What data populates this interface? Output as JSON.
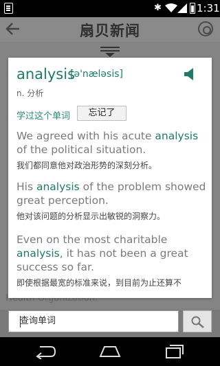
{
  "status_bar": {
    "time": "1:31",
    "icons": [
      "notification-icon",
      "bluetooth-icon",
      "wifi-icon",
      "signal-icon",
      "battery-icon"
    ]
  },
  "app_bar": {
    "title": "扇贝新闻",
    "back_icon": "back-arrow-icon",
    "settings_icon": "gear-icon"
  },
  "card": {
    "word": "analysis",
    "phonetic": "[ə'næləsis]",
    "part_of_speech": "n. 分析",
    "learn_link": "学过这个单词",
    "forgot_button": "忘记了",
    "examples": [
      {
        "en_before": "We agreed with his acute ",
        "en_highlight": "analysis",
        "en_after": " of the political situation.",
        "zh": "我们都同意他对政治形势的深刻分析。"
      },
      {
        "en_before": "His ",
        "en_highlight": "analysis",
        "en_after": " of the problem showed great perception.",
        "zh": "他对该问题的分析显示出敏锐的洞察力。"
      },
      {
        "en_before": "Even on the most charitable ",
        "en_highlight": "analysis",
        "en_after": ", it has not been a great success so far.",
        "zh": "即使根据最宽的标准来说，到目前为止还算不"
      }
    ]
  },
  "background": {
    "ghost_text": "Health Organization."
  },
  "search": {
    "placeholder": "查询单词"
  },
  "colors": {
    "accent": "#1f7a68",
    "example_text": "#7a7a7a"
  }
}
